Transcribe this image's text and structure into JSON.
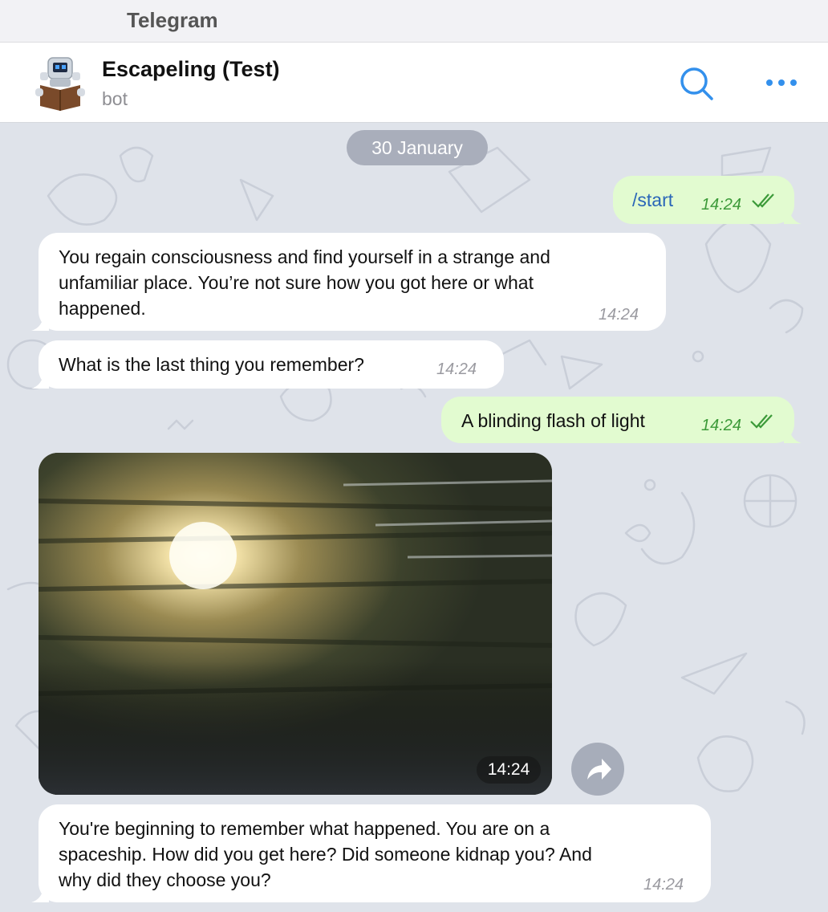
{
  "app": {
    "title": "Telegram"
  },
  "header": {
    "name": "Escapeling (Test)",
    "status": "bot"
  },
  "date_divider": "30 January",
  "messages": [
    {
      "dir": "out",
      "text": "/start",
      "time": "14:24",
      "read": true
    },
    {
      "dir": "in",
      "lines": [
        "You regain consciousness and find yourself in a strange and",
        "unfamiliar place. You’re not sure how you got here or what",
        "happened."
      ],
      "time": "14:24"
    },
    {
      "dir": "in",
      "text": "What is the last thing you remember?",
      "time": "14:24"
    },
    {
      "dir": "out",
      "text": "A blinding flash of light",
      "time": "14:24",
      "read": true
    },
    {
      "dir": "in",
      "type": "photo",
      "time": "14:24"
    },
    {
      "dir": "in",
      "lines": [
        "You're beginning to remember what happened. You are on a",
        "spaceship. How did you get here? Did someone kidnap you? And",
        "why did they choose you?"
      ],
      "time": "14:24"
    }
  ],
  "icons": {
    "search": "search-icon",
    "more": "more-dots-icon",
    "forward": "forward-icon",
    "read": "double-check-icon"
  },
  "colors": {
    "accent": "#3390ec",
    "outgoing_bubble": "#e2fbd0",
    "incoming_bubble": "#ffffff",
    "command_link": "#2a66b8",
    "read_check": "#3c9a39"
  }
}
